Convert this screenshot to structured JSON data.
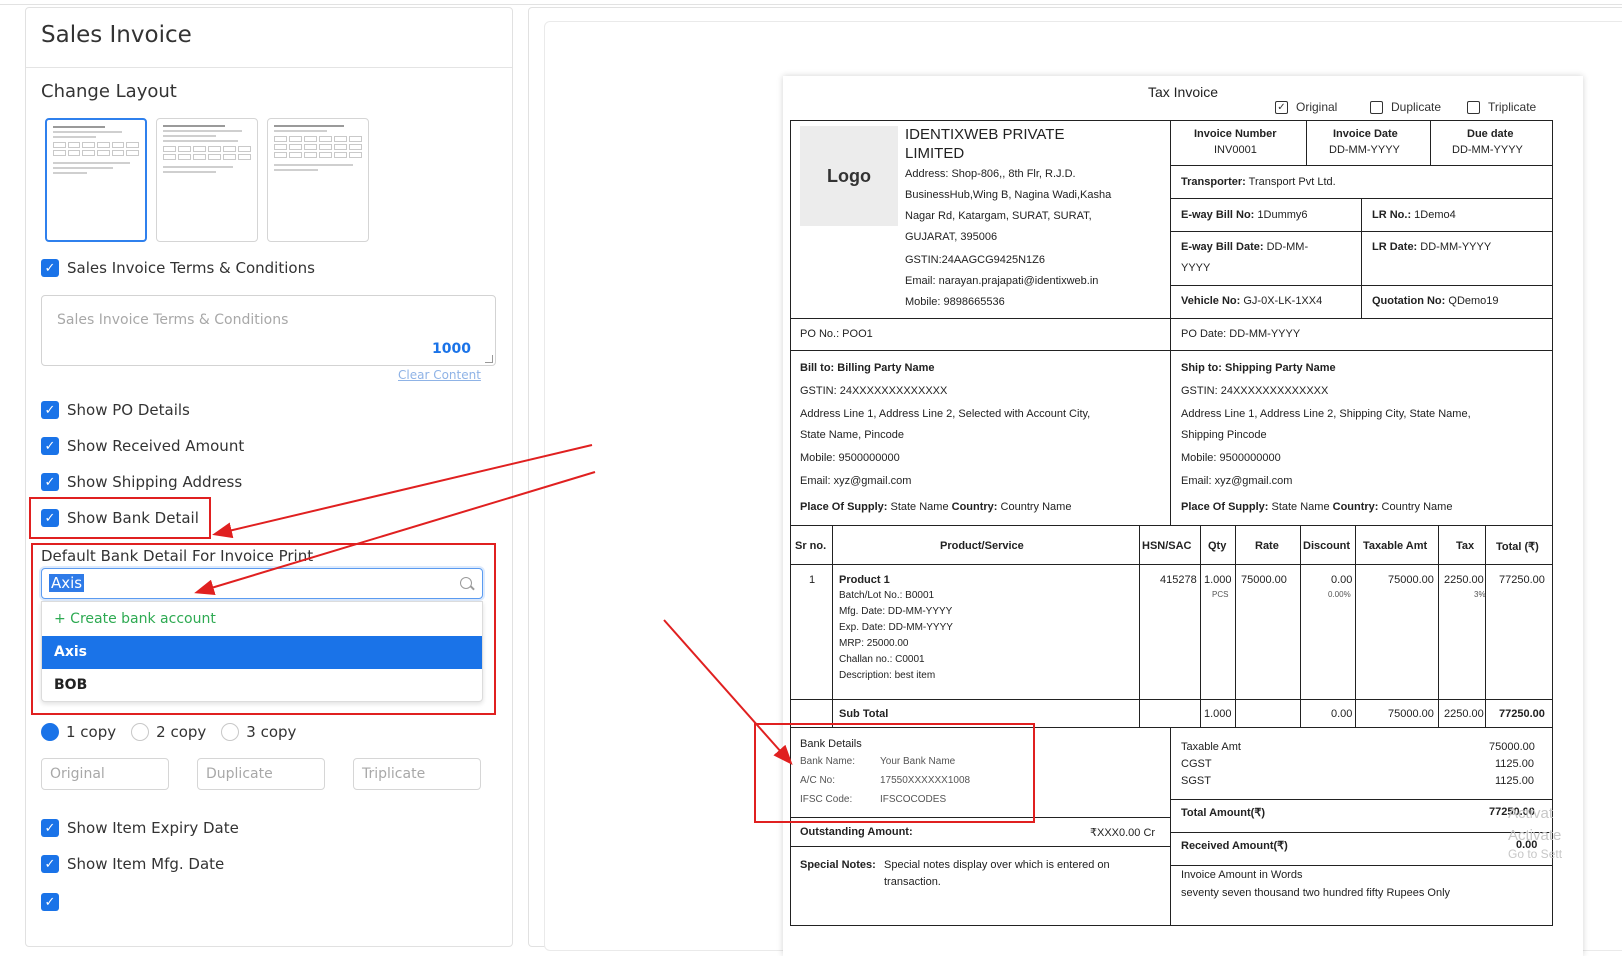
{
  "left": {
    "title": "Sales Invoice",
    "change_layout": "Change Layout",
    "options": [
      {
        "label": "Sales Invoice Terms & Conditions"
      },
      {
        "label": "Show PO Details"
      },
      {
        "label": "Show Received Amount"
      },
      {
        "label": "Show Shipping Address"
      },
      {
        "label": "Show Bank Detail"
      },
      {
        "label": "Show Item Expiry Date"
      },
      {
        "label": "Show Item Mfg. Date"
      }
    ],
    "terms_placeholder": "Sales Invoice Terms & Conditions",
    "terms_count": "1000",
    "clear_content": "Clear Content",
    "default_bank_label": "Default Bank Detail For Invoice Print",
    "bank_search_value": "Axis",
    "dropdown": {
      "create": "+ Create bank account",
      "items": [
        "Axis",
        "BOB"
      ],
      "selected": "Axis"
    },
    "copies": [
      "1 copy",
      "2 copy",
      "3 copy"
    ],
    "copy_labels": [
      "Original",
      "Duplicate",
      "Triplicate"
    ],
    "accent_color": "#1a73e8",
    "highlight_color": "#e02020"
  },
  "invoice": {
    "title": "Tax Invoice",
    "copy_options": [
      "Original",
      "Duplicate",
      "Triplicate"
    ],
    "logo": "Logo",
    "company": {
      "name_line1": "IDENTIXWEB PRIVATE",
      "name_line2": "LIMITED",
      "address1": "Address: Shop-806,, 8th Flr, R.J.D.",
      "address2": "BusinessHub,Wing B, Nagina Wadi,Kasha",
      "address3": "Nagar Rd, Katargam, SURAT, SURAT,",
      "address4": "GUJARAT, 395006",
      "gstin": "GSTIN:24AAGCG9425N1Z6",
      "email": "Email: narayan.prajapati@identixweb.in",
      "mobile": "Mobile: 9898665536"
    },
    "meta": {
      "invoice_number_label": "Invoice Number",
      "invoice_number": "INV0001",
      "invoice_date_label": "Invoice Date",
      "invoice_date": "DD-MM-YYYY",
      "due_date_label": "Due date",
      "due_date": "DD-MM-YYYY",
      "transporter_label": "Transporter:",
      "transporter": "Transport Pvt Ltd.",
      "eway_no_label": "E-way Bill No:",
      "eway_no": "1Dummy6",
      "lr_no_label": "LR No.:",
      "lr_no": "1Demo4",
      "eway_date_label": "E-way Bill Date:",
      "eway_date_1": "DD-MM-",
      "eway_date_2": "YYYY",
      "lr_date_label": "LR Date:",
      "lr_date": "DD-MM-YYYY",
      "vehicle_label": "Vehicle No:",
      "vehicle": "GJ-0X-LK-1XX4",
      "quotation_label": "Quotation No:",
      "quotation": "QDemo19"
    },
    "po": {
      "po_no": "PO No.: POO1",
      "po_date": "PO Date: DD-MM-YYYY"
    },
    "bill_to": {
      "heading_label": "Bill to:",
      "heading": "Billing Party Name",
      "gstin": "GSTIN: 24XXXXXXXXXXXXX",
      "addr1": "Address Line 1, Address Line 2, Selected with Account City,",
      "addr2": "State Name, Pincode",
      "mobile": "Mobile: 9500000000",
      "email": "Email: xyz@gmail.com",
      "pos_label": "Place Of Supply:",
      "pos": "State Name",
      "country_label": "Country:",
      "country": "Country Name"
    },
    "ship_to": {
      "heading_label": "Ship to:",
      "heading": "Shipping Party Name",
      "gstin": "GSTIN: 24XXXXXXXXXXXXX",
      "addr1": "Address Line 1, Address Line 2, Shipping City, State Name,",
      "addr2": "Shipping Pincode",
      "mobile": "Mobile: 9500000000",
      "email": "Email: xyz@gmail.com",
      "pos_label": "Place Of Supply:",
      "pos": "State Name",
      "country_label": "Country:",
      "country": "Country Name"
    },
    "table": {
      "headers": [
        "Sr no.",
        "Product/Service",
        "HSN/SAC",
        "Qty",
        "Rate",
        "Discount",
        "Taxable Amt",
        "Tax",
        "Total (₹)"
      ],
      "row": {
        "sr": "1",
        "product": "Product 1",
        "details": [
          "Batch/Lot No.: B0001",
          "Mfg. Date: DD-MM-YYYY",
          "Exp. Date: DD-MM-YYYY",
          "MRP: 25000.00",
          "Challan no.: C0001",
          "Description: best item"
        ],
        "hsn": "415278",
        "qty": "1.000",
        "unit": "PCS",
        "rate": "75000.00",
        "discount": "0.00",
        "discount_pct": "0.00%",
        "taxable": "75000.00",
        "tax": "2250.00",
        "tax_pct": "3%",
        "total": "77250.00"
      },
      "subtotal": {
        "label": "Sub Total",
        "qty": "1.000",
        "discount": "0.00",
        "taxable": "75000.00",
        "tax": "2250.00",
        "total": "77250.00"
      }
    },
    "bank": {
      "heading": "Bank Details",
      "name_label": "Bank Name:",
      "name": "Your Bank Name",
      "ac_label": "A/C No:",
      "ac": "17550XXXXXX1008",
      "ifsc_label": "IFSC Code:",
      "ifsc": "IFSCOCODES"
    },
    "totals": {
      "taxable_label": "Taxable Amt",
      "taxable": "75000.00",
      "cgst_label": "CGST",
      "cgst": "1125.00",
      "sgst_label": "SGST",
      "sgst": "1125.00",
      "total_label": "Total Amount(₹)",
      "total": "77250.00",
      "received_label": "Received Amount(₹)",
      "received": "0.00",
      "words_label": "Invoice Amount in Words",
      "words": "seventy seven thousand two hundred fifty Rupees Only"
    },
    "outstanding": {
      "label": "Outstanding Amount:",
      "value": "₹XXX0.00 Cr"
    },
    "special": {
      "label": "Special Notes:",
      "line1": "Special notes display over which is entered on",
      "line2": "transaction."
    },
    "watermark1": "Activat",
    "watermark2": "Activate",
    "watermark3": "Go to Sett"
  }
}
